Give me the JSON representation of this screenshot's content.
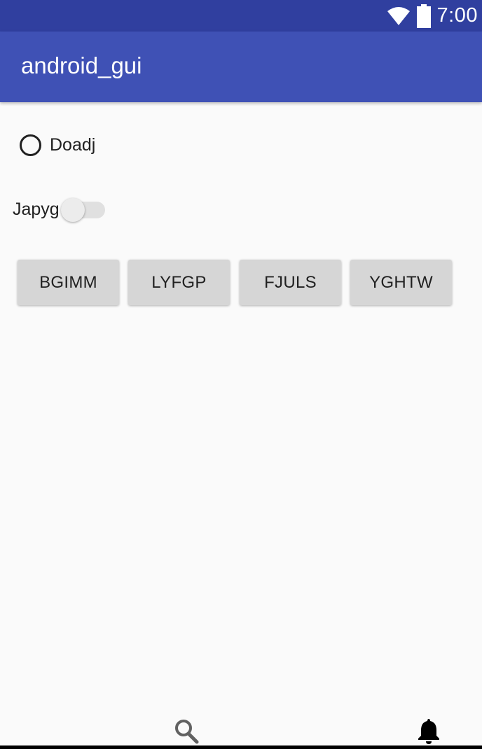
{
  "status_bar": {
    "time": "7:00",
    "icons": [
      "wifi-icon",
      "battery-icon"
    ]
  },
  "app_bar": {
    "title": "android_gui"
  },
  "radio": {
    "label": "Doadj",
    "checked": false
  },
  "switch": {
    "label": "Japyg",
    "on": false
  },
  "buttons": [
    {
      "label": "BGIMM"
    },
    {
      "label": "LYFGP"
    },
    {
      "label": "FJULS"
    },
    {
      "label": "YGHTW"
    }
  ],
  "bottom_bar": {
    "icons": [
      "search-icon",
      "bell-icon"
    ]
  },
  "colors": {
    "status_bar": "#303f9f",
    "app_bar": "#3f51b5",
    "background": "#fafafa",
    "button": "#d6d6d6"
  }
}
